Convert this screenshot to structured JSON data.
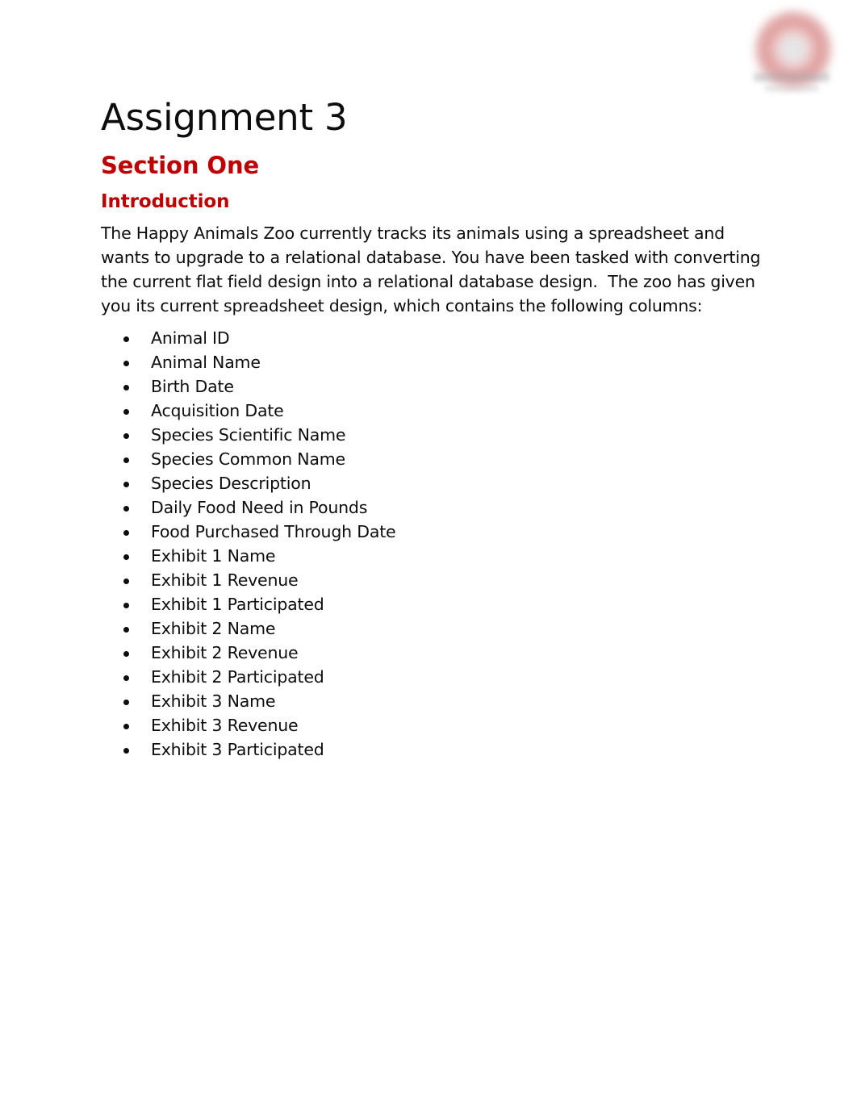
{
  "document": {
    "title": "Assignment 3",
    "section_heading": "Section One",
    "subsection_heading": "Introduction",
    "intro_paragraph": "The Happy Animals Zoo currently tracks its animals using a spreadsheet and wants to upgrade to a relational database. You have been tasked with converting the current flat field design into a relational database design.  The zoo has given you its current spreadsheet design, which contains the following columns:",
    "spreadsheet_columns": [
      "Animal ID",
      "Animal Name",
      "Birth Date",
      "Acquisition Date",
      "Species Scientific Name",
      "Species Common Name",
      "Species Description",
      "Daily Food Need in Pounds",
      "Food Purchased Through Date",
      "Exhibit 1 Name",
      "Exhibit 1 Revenue",
      "Exhibit 1 Participated",
      "Exhibit 2 Name",
      "Exhibit 2 Revenue",
      "Exhibit 2 Participated",
      "Exhibit 3 Name",
      "Exhibit 3 Revenue",
      "Exhibit 3 Participated"
    ]
  },
  "logo": {
    "name": "organization-logo-watermark",
    "description": "blurred red ring logo"
  },
  "colors": {
    "heading_red": "#C00000",
    "body_text": "#0D0D0D",
    "page_background": "#FFFFFF",
    "logo_red": "#D37A7A"
  }
}
